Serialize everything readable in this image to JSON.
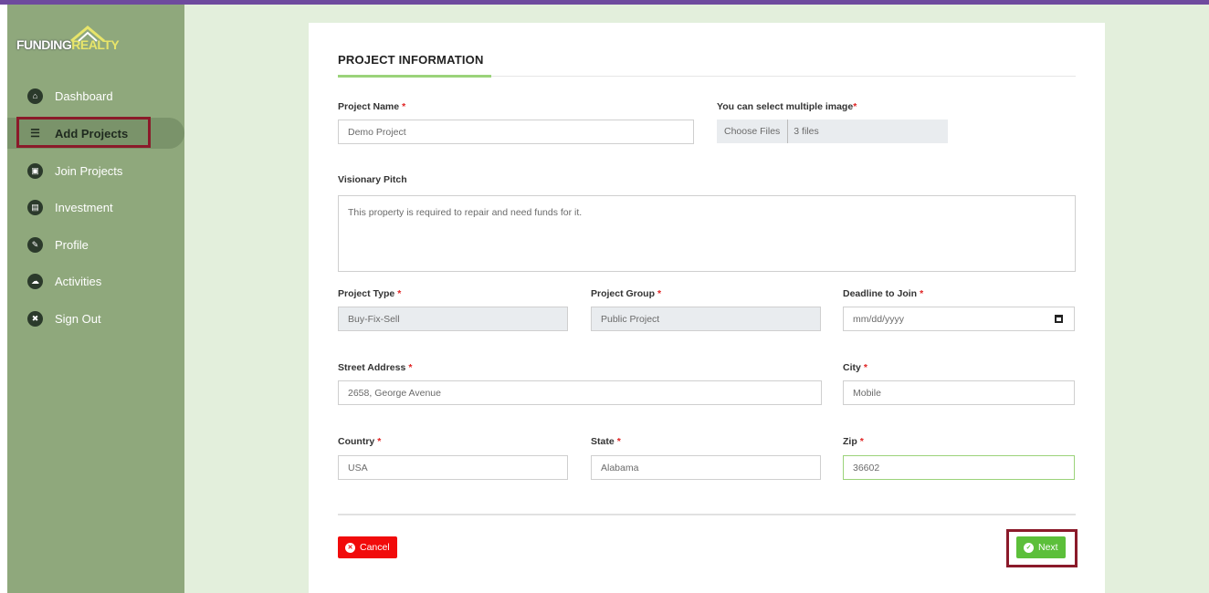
{
  "brand": {
    "part1": "FUNDING",
    "part2": "REALTY"
  },
  "sidebar": {
    "items": [
      {
        "label": "Dashboard",
        "icon": "home-icon",
        "glyph": "⌂"
      },
      {
        "label": "Add Projects",
        "icon": "list-icon",
        "glyph": "☰"
      },
      {
        "label": "Join Projects",
        "icon": "id-card-icon",
        "glyph": "▣"
      },
      {
        "label": "Investment",
        "icon": "book-icon",
        "glyph": "▤"
      },
      {
        "label": "Profile",
        "icon": "pencil-icon",
        "glyph": "✎"
      },
      {
        "label": "Activities",
        "icon": "cloud-icon",
        "glyph": "☁"
      },
      {
        "label": "Sign Out",
        "icon": "times-circle-icon",
        "glyph": "✖"
      }
    ],
    "active_index": 1
  },
  "form": {
    "section_title": "PROJECT INFORMATION",
    "project_name": {
      "label": "Project Name",
      "value": "Demo Project"
    },
    "images": {
      "label": "You can select multiple image",
      "button": "Choose Files",
      "count": "3 files"
    },
    "pitch": {
      "label": "Visionary Pitch",
      "value": "This property is required to repair and need funds for it."
    },
    "project_type": {
      "label": "Project Type",
      "value": "Buy-Fix-Sell"
    },
    "project_group": {
      "label": "Project Group",
      "value": "Public Project"
    },
    "deadline": {
      "label": "Deadline to Join",
      "placeholder": "mm/dd/yyyy"
    },
    "street": {
      "label": "Street Address",
      "value": "2658, George Avenue"
    },
    "city": {
      "label": "City",
      "value": "Mobile"
    },
    "country": {
      "label": "Country",
      "value": "USA"
    },
    "state": {
      "label": "State",
      "value": "Alabama"
    },
    "zip": {
      "label": "Zip",
      "value": "36602"
    },
    "required_mark": "*"
  },
  "buttons": {
    "cancel": "Cancel",
    "next": "Next"
  },
  "colors": {
    "sidebar": "#8fa87c",
    "accent_green": "#5cbf3a",
    "danger": "#f10b0b",
    "highlight": "#8b1a2a"
  }
}
